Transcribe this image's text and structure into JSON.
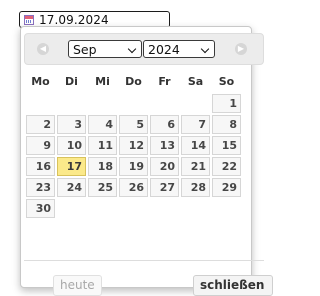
{
  "date_input": {
    "value": "17.09.2024",
    "icon": "calendar-icon"
  },
  "datepicker": {
    "nav": {
      "prev_icon": "chevron-left-icon",
      "next_icon": "chevron-right-icon"
    },
    "month_select": {
      "selected": "Sep"
    },
    "year_select": {
      "selected": "2024"
    },
    "weekdays": [
      "Mo",
      "Di",
      "Mi",
      "Do",
      "Fr",
      "Sa",
      "So"
    ],
    "weeks": [
      [
        "",
        "",
        "",
        "",
        "",
        "",
        "1"
      ],
      [
        "2",
        "3",
        "4",
        "5",
        "6",
        "7",
        "8"
      ],
      [
        "9",
        "10",
        "11",
        "12",
        "13",
        "14",
        "15"
      ],
      [
        "16",
        "17",
        "18",
        "19",
        "20",
        "21",
        "22"
      ],
      [
        "23",
        "24",
        "25",
        "26",
        "27",
        "28",
        "29"
      ],
      [
        "30",
        "",
        "",
        "",
        "",
        "",
        ""
      ]
    ],
    "highlighted_day": "17",
    "today_button": "heute",
    "close_button": "schließen",
    "colors": {
      "highlight": "#fbe98a",
      "cell_bg": "#f7f7f7",
      "header_bg": "#ececec"
    }
  }
}
